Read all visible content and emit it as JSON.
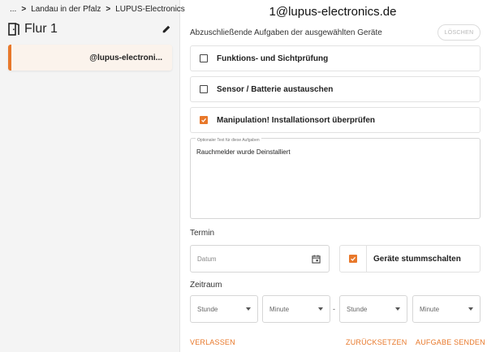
{
  "sidebar": {
    "breadcrumb": [
      "...",
      "Landau in der Pfalz",
      "LUPUS-Electronics"
    ],
    "room_title": "Flur 1",
    "device_label": "@lupus-electroni..."
  },
  "main": {
    "title": "1@lupus-electronics.de",
    "tasks_heading": "Abzuschließende Aufgaben der ausgewählten Geräte",
    "delete_label": "LÖSCHEN",
    "tasks": [
      {
        "label": "Funktions- und Sichtprüfung",
        "checked": false
      },
      {
        "label": "Sensor / Batterie austauschen",
        "checked": false
      },
      {
        "label": "Manipulation! Installationsort überprüfen",
        "checked": true
      }
    ],
    "notes": {
      "label": "Optionaler Text für diese Aufgaben",
      "value": "Rauchmelder wurde Deinstalliert"
    },
    "termin_label": "Termin",
    "date_placeholder": "Datum",
    "mute_label": "Geräte stummschalten",
    "mute_checked": true,
    "zeitraum_label": "Zeitraum",
    "from_hour": "Stunde",
    "from_minute": "Minute",
    "range_separator": "-",
    "to_hour": "Stunde",
    "to_minute": "Minute"
  },
  "footer": {
    "leave": "VERLASSEN",
    "reset": "ZURÜCKSETZEN",
    "send": "AUFGABE SENDEN"
  },
  "colors": {
    "accent": "#e8782a",
    "sidebar_bg": "#f4f4f4",
    "selected_card_bg": "#fbf3ec"
  },
  "icons": [
    "door-icon",
    "pencil-icon",
    "calendar-icon",
    "check-icon",
    "chevron-right-icon",
    "caret-down-icon"
  ]
}
